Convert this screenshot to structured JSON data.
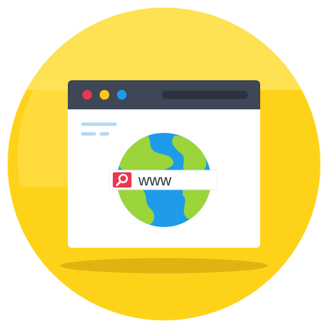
{
  "icon": {
    "name": "web-browser-globe-search-icon",
    "search_text": "www"
  },
  "colors": {
    "background_circle": "#FFD21A",
    "background_highlight": "#FFE35A",
    "ground_shadow": "#E0B410",
    "window_body": "#FFFFFF",
    "title_bar": "#3D4756",
    "address_bar": "#2B333F",
    "dot_red": "#E8384F",
    "dot_yellow": "#FFC61A",
    "dot_blue": "#1E9BE9",
    "sidebar_lines": "#B7D9F4",
    "globe_ocean": "#1E9BE9",
    "globe_land": "#9BD43B",
    "search_bar": "#FFFFFF",
    "search_icon_bg": "#E8384F",
    "search_text": "#2B333F"
  }
}
